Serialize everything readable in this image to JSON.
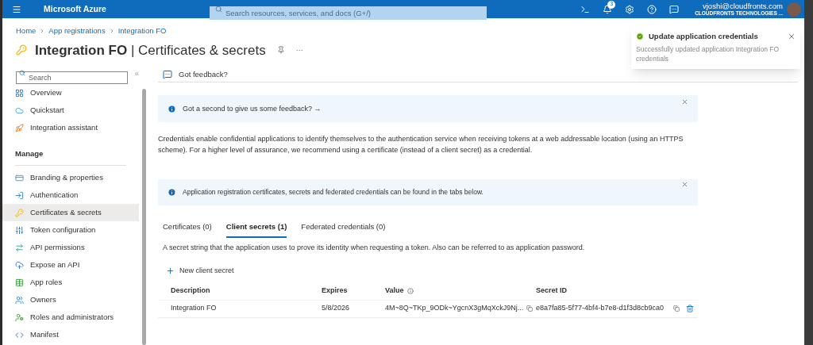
{
  "topbar": {
    "brand": "Microsoft Azure",
    "search": {
      "placeholder": "Search resources, services, and docs (G+/)"
    },
    "notification_count": "3",
    "account": {
      "email": "vjoshi@cloudfronts.com",
      "tenant": "CLOUDFRONTS TECHNOLOGIES ..."
    }
  },
  "breadcrumb": [
    "Home",
    "App registrations",
    "Integration FO"
  ],
  "page_title": {
    "resource": "Integration FO",
    "separator": "|",
    "section": "Certificates & secrets",
    "more": "···"
  },
  "sidebar": {
    "search": {
      "placeholder": "Search"
    },
    "collapse": "«",
    "items": [
      {
        "kind": "item",
        "label": "Overview",
        "selected": false
      },
      {
        "kind": "item",
        "label": "Quickstart",
        "selected": false
      },
      {
        "kind": "item",
        "label": "Integration assistant",
        "selected": false
      },
      {
        "kind": "section",
        "label": "Manage"
      },
      {
        "kind": "item",
        "label": "Branding & properties",
        "selected": false
      },
      {
        "kind": "item",
        "label": "Authentication",
        "selected": false
      },
      {
        "kind": "item",
        "label": "Certificates & secrets",
        "selected": true
      },
      {
        "kind": "item",
        "label": "Token configuration",
        "selected": false
      },
      {
        "kind": "item",
        "label": "API permissions",
        "selected": false
      },
      {
        "kind": "item",
        "label": "Expose an API",
        "selected": false
      },
      {
        "kind": "item",
        "label": "App roles",
        "selected": false
      },
      {
        "kind": "item",
        "label": "Owners",
        "selected": false
      },
      {
        "kind": "item",
        "label": "Roles and administrators",
        "selected": false
      },
      {
        "kind": "item",
        "label": "Manifest",
        "selected": false
      }
    ]
  },
  "toolbar": {
    "feedback": "Got feedback?"
  },
  "banners": [
    {
      "text": "Got a second to give us some feedback? →"
    },
    {
      "text": "Application registration certificates, secrets and federated credentials can be found in the tabs below."
    }
  ],
  "intro": "Credentials enable confidential applications to identify themselves to the authentication service when receiving tokens at a web addressable location (using an HTTPS scheme). For a higher level of assurance, we recommend using a certificate (instead of a client secret) as a credential.",
  "tabs": [
    {
      "label": "Certificates (0)",
      "selected": false
    },
    {
      "label": "Client secrets (1)",
      "selected": true
    },
    {
      "label": "Federated credentials (0)",
      "selected": false
    }
  ],
  "tab_description": "A secret string that the application uses to prove its identity when requesting a token. Also can be referred to as application password.",
  "new_button": "New client secret",
  "table": {
    "columns": [
      "Description",
      "Expires",
      "Value",
      "Secret ID"
    ],
    "rows": [
      {
        "description": "Integration FO",
        "expires": "5/8/2026",
        "value": "4M~8Q~TKp_9ODk~YgcnX3gMqXckJ9Nj...",
        "secret_id": "e8a7fa85-5f77-4bf4-b7e8-d1f3d8cb9ca0"
      }
    ]
  },
  "toast": {
    "title": "Update application credentials",
    "message": "Successfully updated application Integration FO credentials"
  }
}
